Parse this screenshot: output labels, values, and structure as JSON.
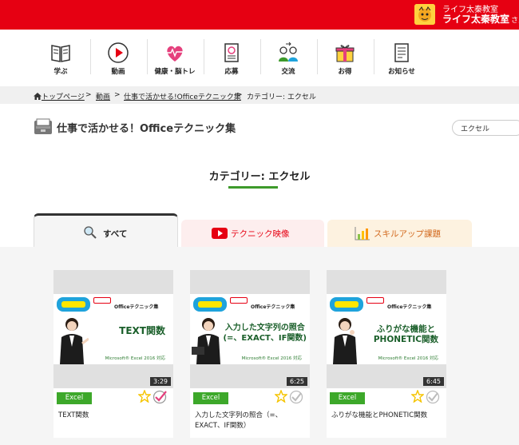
{
  "header": {
    "org_name": "ライフ太秦教室",
    "user_name": "ライフ太秦教室",
    "user_suffix": "さん"
  },
  "nav": {
    "items": [
      {
        "label": "学ぶ",
        "icon": "book-icon"
      },
      {
        "label": "動画",
        "icon": "play-icon"
      },
      {
        "label": "健康・脳トレ",
        "icon": "heart-pulse-icon"
      },
      {
        "label": "応募",
        "icon": "application-form-icon"
      },
      {
        "label": "交流",
        "icon": "people-exchange-icon"
      },
      {
        "label": "お得",
        "icon": "gift-icon"
      },
      {
        "label": "お知らせ",
        "icon": "notice-icon"
      }
    ]
  },
  "breadcrumb": {
    "home": "トップページ",
    "video": "動画",
    "series": "仕事で活かせる!Officeテクニック集",
    "current": "カテゴリー: エクセル"
  },
  "page": {
    "title": "仕事で活かせる！Officeテクニック集",
    "category_select": "エクセル",
    "category_heading": "カテゴリー: エクセル"
  },
  "tabs": {
    "all": "すべて",
    "video": "テクニック映像",
    "skill": "スキルアップ課題"
  },
  "thumb_brand": "Officeテクニック集",
  "thumb_version": "Microsoft® Excel 2016 対応",
  "cards": [
    {
      "headline": "TEXT関数",
      "duration": "3:29",
      "tag": "Excel",
      "title": "TEXT関数",
      "checked": true
    },
    {
      "headline": "入力した文字列の照合\n(=、EXACT、IF関数)",
      "duration": "6:25",
      "tag": "Excel",
      "title": "入力した文字列の照合（=、EXACT、IF関数）",
      "checked": false
    },
    {
      "headline": "ふりがな機能と\nPHONETIC関数",
      "duration": "6:45",
      "tag": "Excel",
      "title": "ふりがな機能とPHONETIC関数",
      "checked": false
    }
  ],
  "colors": {
    "brand_red": "#e60012",
    "accent_green": "#3da82a",
    "star_yellow": "#f5c400"
  }
}
